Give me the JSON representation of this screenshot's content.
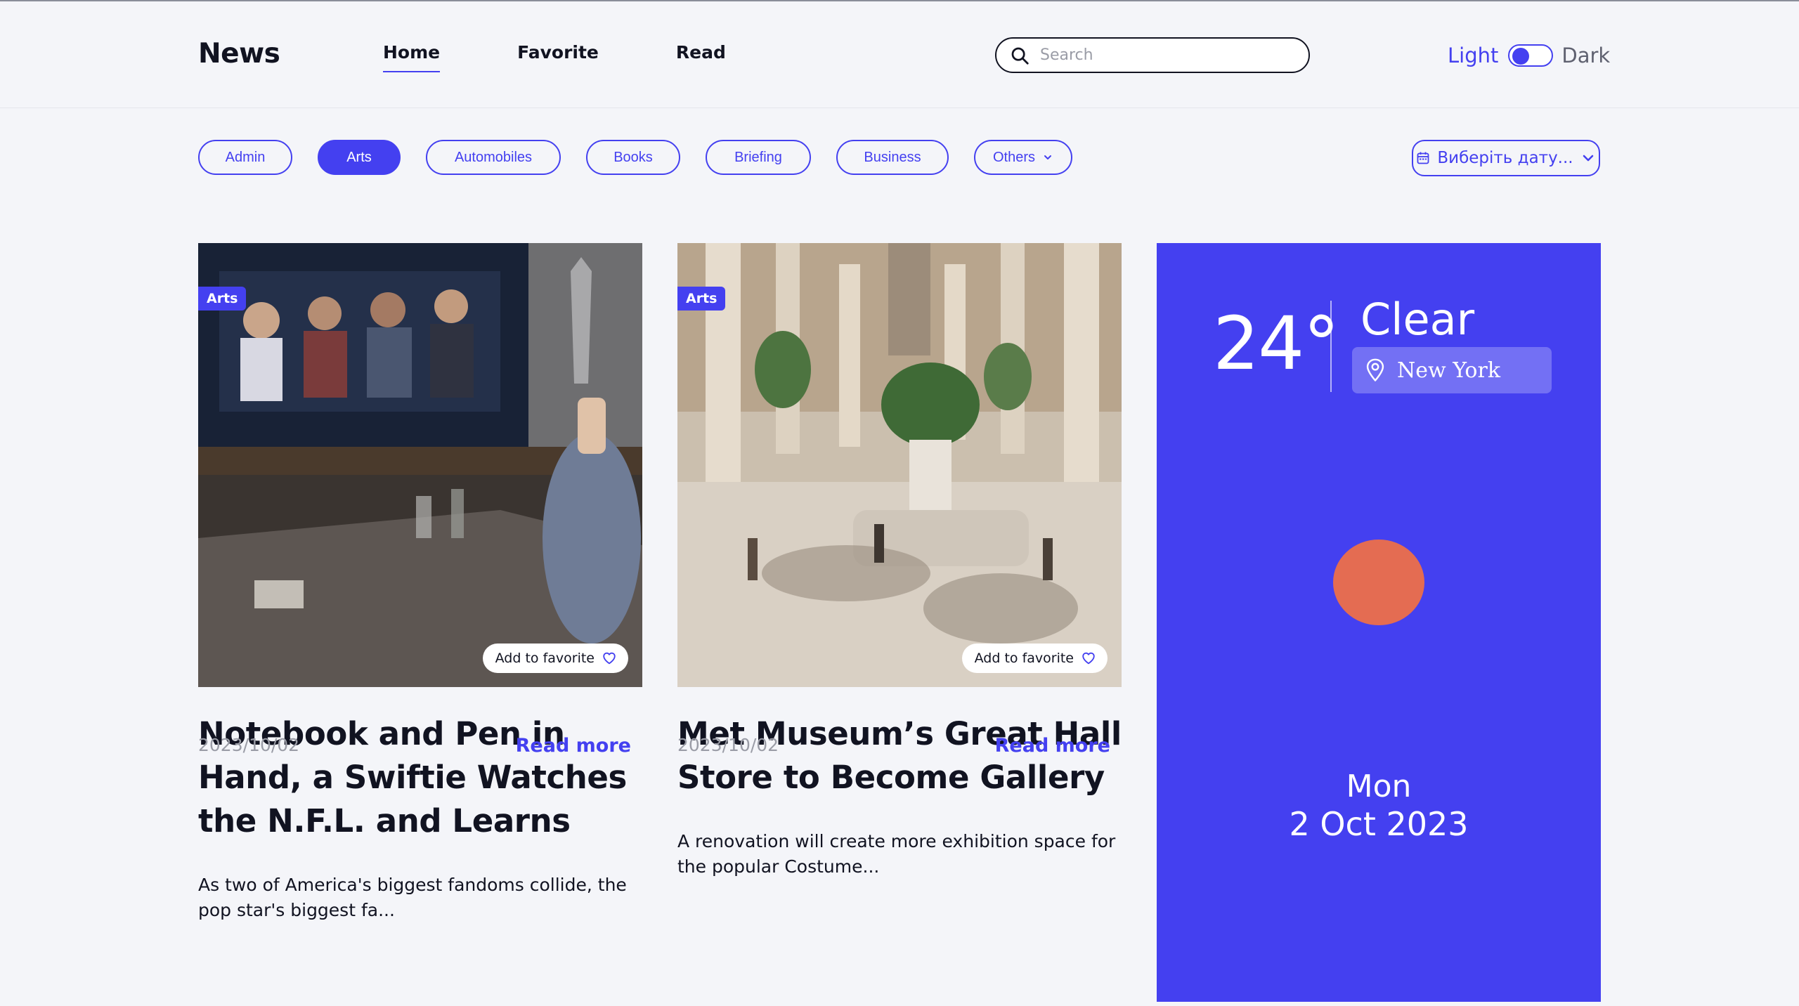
{
  "header": {
    "logo": "News",
    "nav": [
      {
        "label": "Home",
        "active": true
      },
      {
        "label": "Favorite",
        "active": false
      },
      {
        "label": "Read",
        "active": false
      }
    ],
    "search": {
      "placeholder": "Search",
      "value": ""
    },
    "theme": {
      "light_label": "Light",
      "dark_label": "Dark",
      "mode": "light"
    }
  },
  "filters": {
    "categories": [
      {
        "label": "Admin",
        "active": false
      },
      {
        "label": "Arts",
        "active": true
      },
      {
        "label": "Automobiles",
        "active": false
      },
      {
        "label": "Books",
        "active": false
      },
      {
        "label": "Briefing",
        "active": false
      },
      {
        "label": "Business",
        "active": false
      },
      {
        "label": "Others",
        "active": false
      }
    ],
    "date_picker_label": "Виберіть дату..."
  },
  "articles": [
    {
      "category": "Arts",
      "favorite_label": "Add to favorite",
      "title": "Notebook and Pen in Hand, a Swiftie Watches the N.F.L. and Learns",
      "description": "As two of America's biggest fandoms collide, the pop star's biggest fa...",
      "date": "2023/10/02",
      "read_more": "Read more"
    },
    {
      "category": "Arts",
      "favorite_label": "Add to favorite",
      "title": "Met Museum’s Great Hall Store to Become Gallery",
      "description": "A renovation will create more exhibition space for the popular Costume...",
      "date": "2023/10/02",
      "read_more": "Read more"
    }
  ],
  "weather": {
    "temperature": "24°",
    "condition": "Clear",
    "location": "New York",
    "day": "Mon",
    "date": "2 Oct 2023"
  },
  "colors": {
    "accent": "#4440f0",
    "sun": "#e46c52",
    "background": "#f4f5f9",
    "muted": "#9a9ca6"
  },
  "icons": {
    "search": "search-icon",
    "toggle": "theme-toggle",
    "calendar": "calendar-icon",
    "chevron": "chevron-down-icon",
    "heart": "heart-icon",
    "location": "map-pin-icon"
  }
}
